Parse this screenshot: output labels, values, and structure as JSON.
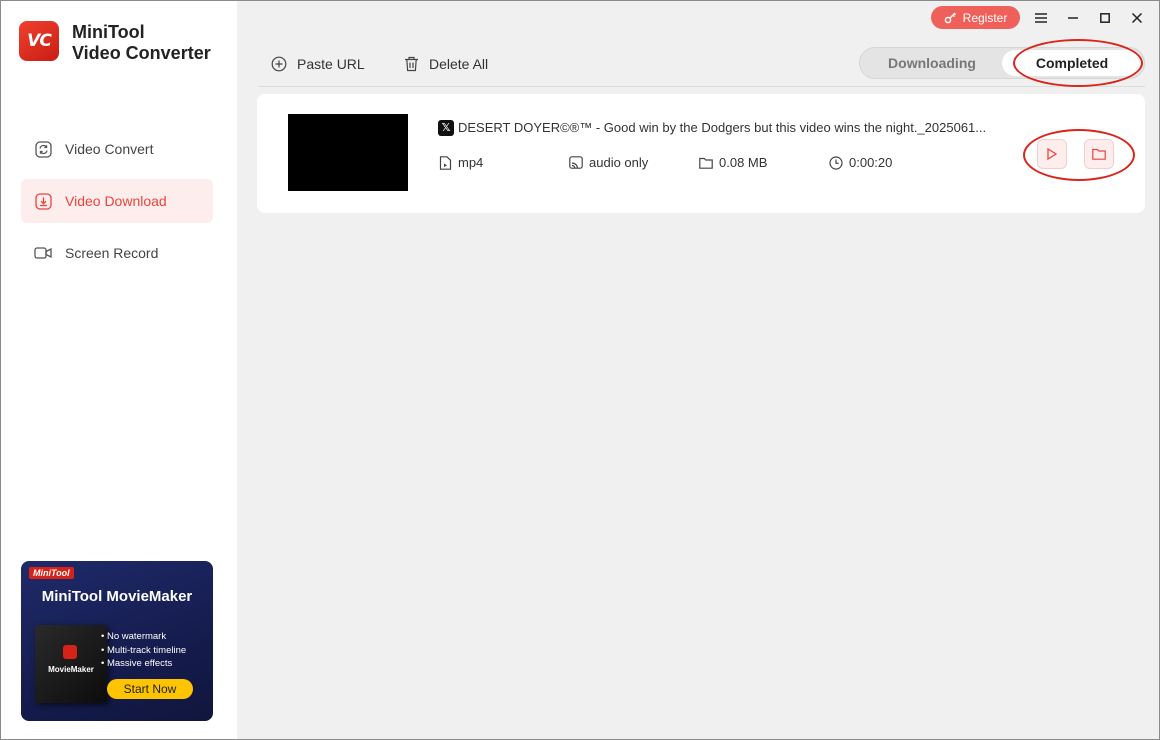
{
  "app": {
    "logo_text": "VC",
    "name_line1": "MiniTool",
    "name_line2": "Video Converter"
  },
  "sidebar": {
    "items": [
      {
        "label": "Video Convert",
        "icon": "convert-icon",
        "active": false
      },
      {
        "label": "Video Download",
        "icon": "download-icon",
        "active": true
      },
      {
        "label": "Screen Record",
        "icon": "camera-icon",
        "active": false
      }
    ]
  },
  "ad": {
    "brand": "MiniTool",
    "title": "MiniTool MovieMaker",
    "box_label": "MovieMaker",
    "features": [
      "• No watermark",
      "• Multi-track timeline",
      "• Massive effects"
    ],
    "button": "Start Now"
  },
  "titlebar": {
    "register": "Register"
  },
  "toolbar": {
    "paste_url": "Paste URL",
    "delete_all": "Delete All"
  },
  "tabs": {
    "downloading": "Downloading",
    "completed": "Completed",
    "active": "completed"
  },
  "download_item": {
    "source_icon": "x-logo-icon",
    "title": "DESERT DOYER©®™ - Good win by the Dodgers but this video wins the night._2025061...",
    "format": "mp4",
    "type": "audio only",
    "size": "0.08 MB",
    "duration": "0:00:20"
  },
  "colors": {
    "accent": "#e8453c",
    "active_bg": "#fdeeed",
    "register_bg": "#f0605a",
    "annotation": "#d9261c"
  }
}
